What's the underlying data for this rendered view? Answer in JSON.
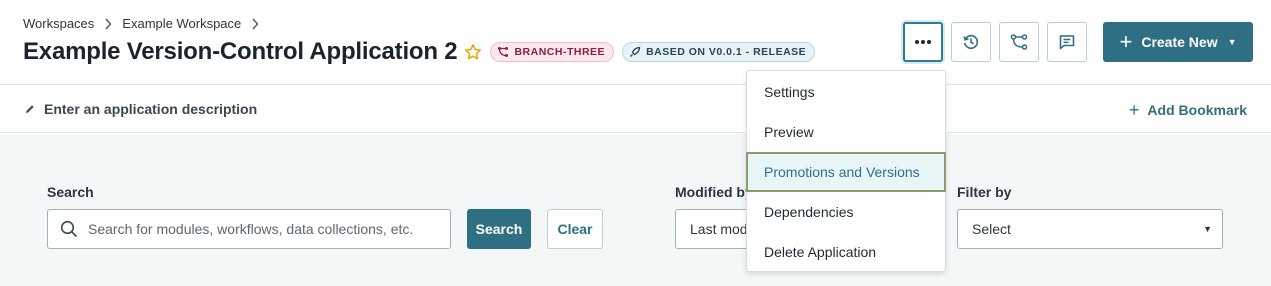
{
  "breadcrumb": {
    "items": [
      "Workspaces",
      "Example Workspace"
    ]
  },
  "app": {
    "title": "Example Version-Control Application 2",
    "branch_badge": "BRANCH-THREE",
    "based_on_badge": "BASED ON V0.0.1 - RELEASE"
  },
  "toolbar": {
    "create_new": "Create New"
  },
  "description": {
    "placeholder": "Enter an application description",
    "add_bookmark": "Add Bookmark"
  },
  "filters": {
    "search_label": "Search",
    "search_placeholder": "Search for modules, workflows, data collections, etc.",
    "search_button": "Search",
    "clear_button": "Clear",
    "modified_by_label": "Modified by",
    "modified_by_value": "Last modified",
    "filter_by_label": "Filter by",
    "filter_by_value": "Select"
  },
  "more_menu": {
    "items": [
      "Settings",
      "Preview",
      "Promotions and Versions",
      "Dependencies",
      "Delete Application"
    ],
    "selected": "Promotions and Versions"
  },
  "colors": {
    "primary": "#2f6f84",
    "star": "#e0a800",
    "branch_badge_text": "#8b1e4a",
    "filter_bg": "#f3f7f8"
  }
}
